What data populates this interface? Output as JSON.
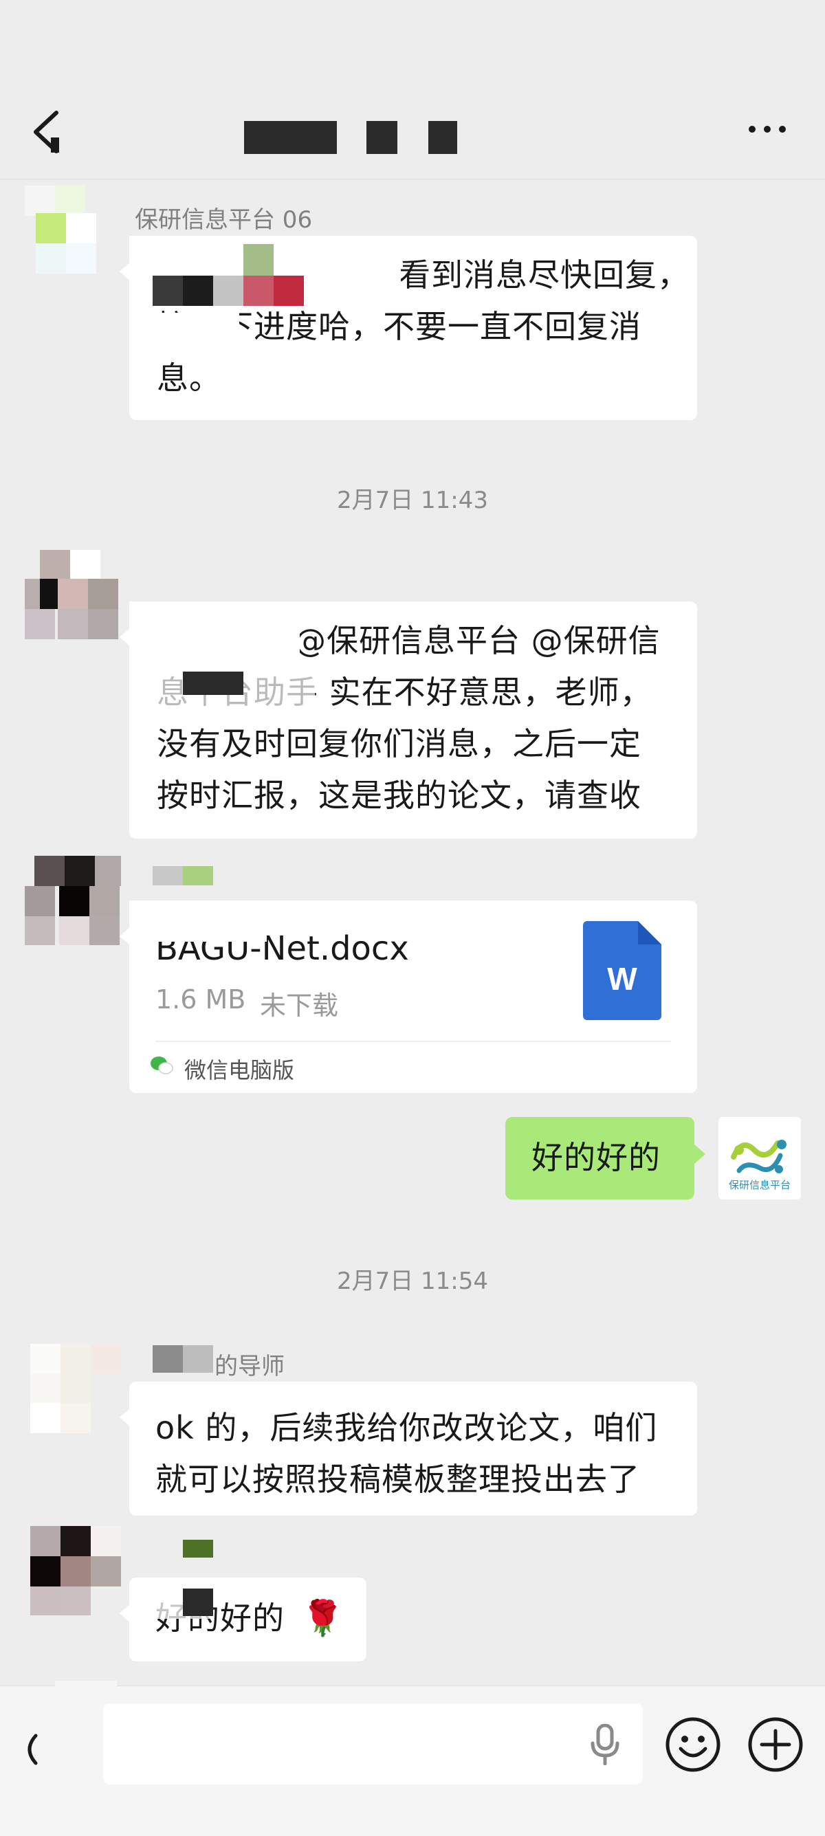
{
  "header": {
    "back_icon": "chevron-left-icon",
    "more_icon": "more-horizontal-icon"
  },
  "messages": {
    "m1": {
      "sender": "保研信息平台 06",
      "line1": "看到消息尽快回复，",
      "line2": "搞一下进度哈，不要一直不回复消",
      "line3": "息。"
    },
    "time1": "2月7日 11:43",
    "m2": {
      "line1": "@保研信息平台 @保研信",
      "line2": "息平台助手  实在不好意思，老师，",
      "line3": "没有及时回复你们消息，之后一定",
      "line4": "按时汇报，这是我的论文，请查收"
    },
    "file": {
      "name": "BAGU-Net.docx",
      "size": "1.6 MB",
      "status": "未下载",
      "source": "微信电脑版",
      "icon_letter": "W"
    },
    "self_reply": "好的好的",
    "self_avatar_label": "保研信息平台",
    "time2": "2月7日 11:54",
    "m3": {
      "sender": "的导师",
      "line1": "ok 的，后续我给你改改论文，咱们",
      "line2": "就可以按照投稿模板整理投出去了"
    },
    "m4": {
      "text": "好的好的",
      "emoji": "🌹"
    }
  },
  "input": {
    "placeholder": "",
    "voice_icon": "microphone-icon",
    "emoji_icon": "emoji-icon",
    "plus_icon": "plus-icon"
  },
  "colors": {
    "background": "#ededed",
    "self_bubble": "#a9e97a",
    "word_blue": "#2f6fd6"
  }
}
